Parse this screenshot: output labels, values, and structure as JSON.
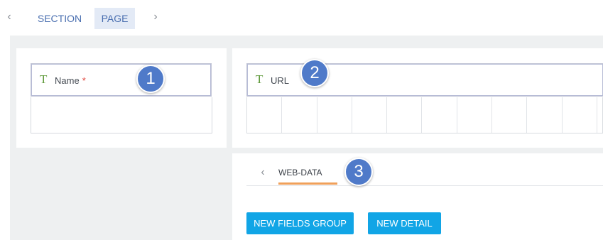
{
  "nav": {
    "back_glyph": "‹",
    "forward_glyph": "›",
    "tabs": [
      {
        "label": "SECTION",
        "active": false
      },
      {
        "label": "PAGE",
        "active": true
      }
    ]
  },
  "fields": {
    "name": {
      "type_glyph": "T",
      "label": "Name",
      "required_mark": "*"
    },
    "url": {
      "type_glyph": "T",
      "label": "URL"
    }
  },
  "badges": [
    "1",
    "2",
    "3"
  ],
  "details": {
    "back_glyph": "‹",
    "tab_label": "WEB-DATA"
  },
  "buttons": {
    "new_fields_group": "NEW FIELDS GROUP",
    "new_detail": "NEW DETAIL"
  },
  "colors": {
    "accent": "#11a5e6",
    "badge": "#4f7ac9",
    "tab_underline": "#f0a05a",
    "type_icon": "#5f9a3a",
    "required": "#e0433b"
  }
}
